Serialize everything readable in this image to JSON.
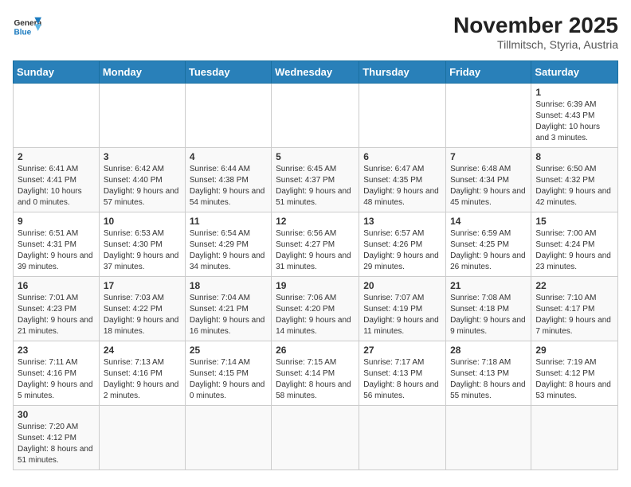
{
  "header": {
    "logo_general": "General",
    "logo_blue": "Blue",
    "month_year": "November 2025",
    "location": "Tillmitsch, Styria, Austria"
  },
  "days_of_week": [
    "Sunday",
    "Monday",
    "Tuesday",
    "Wednesday",
    "Thursday",
    "Friday",
    "Saturday"
  ],
  "weeks": [
    [
      null,
      null,
      null,
      null,
      null,
      null,
      {
        "num": "1",
        "info": "Sunrise: 6:39 AM\nSunset: 4:43 PM\nDaylight: 10 hours and 3 minutes."
      }
    ],
    [
      {
        "num": "2",
        "info": "Sunrise: 6:41 AM\nSunset: 4:41 PM\nDaylight: 10 hours and 0 minutes."
      },
      {
        "num": "3",
        "info": "Sunrise: 6:42 AM\nSunset: 4:40 PM\nDaylight: 9 hours and 57 minutes."
      },
      {
        "num": "4",
        "info": "Sunrise: 6:44 AM\nSunset: 4:38 PM\nDaylight: 9 hours and 54 minutes."
      },
      {
        "num": "5",
        "info": "Sunrise: 6:45 AM\nSunset: 4:37 PM\nDaylight: 9 hours and 51 minutes."
      },
      {
        "num": "6",
        "info": "Sunrise: 6:47 AM\nSunset: 4:35 PM\nDaylight: 9 hours and 48 minutes."
      },
      {
        "num": "7",
        "info": "Sunrise: 6:48 AM\nSunset: 4:34 PM\nDaylight: 9 hours and 45 minutes."
      },
      {
        "num": "8",
        "info": "Sunrise: 6:50 AM\nSunset: 4:32 PM\nDaylight: 9 hours and 42 minutes."
      }
    ],
    [
      {
        "num": "9",
        "info": "Sunrise: 6:51 AM\nSunset: 4:31 PM\nDaylight: 9 hours and 39 minutes."
      },
      {
        "num": "10",
        "info": "Sunrise: 6:53 AM\nSunset: 4:30 PM\nDaylight: 9 hours and 37 minutes."
      },
      {
        "num": "11",
        "info": "Sunrise: 6:54 AM\nSunset: 4:29 PM\nDaylight: 9 hours and 34 minutes."
      },
      {
        "num": "12",
        "info": "Sunrise: 6:56 AM\nSunset: 4:27 PM\nDaylight: 9 hours and 31 minutes."
      },
      {
        "num": "13",
        "info": "Sunrise: 6:57 AM\nSunset: 4:26 PM\nDaylight: 9 hours and 29 minutes."
      },
      {
        "num": "14",
        "info": "Sunrise: 6:59 AM\nSunset: 4:25 PM\nDaylight: 9 hours and 26 minutes."
      },
      {
        "num": "15",
        "info": "Sunrise: 7:00 AM\nSunset: 4:24 PM\nDaylight: 9 hours and 23 minutes."
      }
    ],
    [
      {
        "num": "16",
        "info": "Sunrise: 7:01 AM\nSunset: 4:23 PM\nDaylight: 9 hours and 21 minutes."
      },
      {
        "num": "17",
        "info": "Sunrise: 7:03 AM\nSunset: 4:22 PM\nDaylight: 9 hours and 18 minutes."
      },
      {
        "num": "18",
        "info": "Sunrise: 7:04 AM\nSunset: 4:21 PM\nDaylight: 9 hours and 16 minutes."
      },
      {
        "num": "19",
        "info": "Sunrise: 7:06 AM\nSunset: 4:20 PM\nDaylight: 9 hours and 14 minutes."
      },
      {
        "num": "20",
        "info": "Sunrise: 7:07 AM\nSunset: 4:19 PM\nDaylight: 9 hours and 11 minutes."
      },
      {
        "num": "21",
        "info": "Sunrise: 7:08 AM\nSunset: 4:18 PM\nDaylight: 9 hours and 9 minutes."
      },
      {
        "num": "22",
        "info": "Sunrise: 7:10 AM\nSunset: 4:17 PM\nDaylight: 9 hours and 7 minutes."
      }
    ],
    [
      {
        "num": "23",
        "info": "Sunrise: 7:11 AM\nSunset: 4:16 PM\nDaylight: 9 hours and 5 minutes."
      },
      {
        "num": "24",
        "info": "Sunrise: 7:13 AM\nSunset: 4:16 PM\nDaylight: 9 hours and 2 minutes."
      },
      {
        "num": "25",
        "info": "Sunrise: 7:14 AM\nSunset: 4:15 PM\nDaylight: 9 hours and 0 minutes."
      },
      {
        "num": "26",
        "info": "Sunrise: 7:15 AM\nSunset: 4:14 PM\nDaylight: 8 hours and 58 minutes."
      },
      {
        "num": "27",
        "info": "Sunrise: 7:17 AM\nSunset: 4:13 PM\nDaylight: 8 hours and 56 minutes."
      },
      {
        "num": "28",
        "info": "Sunrise: 7:18 AM\nSunset: 4:13 PM\nDaylight: 8 hours and 55 minutes."
      },
      {
        "num": "29",
        "info": "Sunrise: 7:19 AM\nSunset: 4:12 PM\nDaylight: 8 hours and 53 minutes."
      }
    ],
    [
      {
        "num": "30",
        "info": "Sunrise: 7:20 AM\nSunset: 4:12 PM\nDaylight: 8 hours and 51 minutes."
      },
      null,
      null,
      null,
      null,
      null,
      null
    ]
  ]
}
